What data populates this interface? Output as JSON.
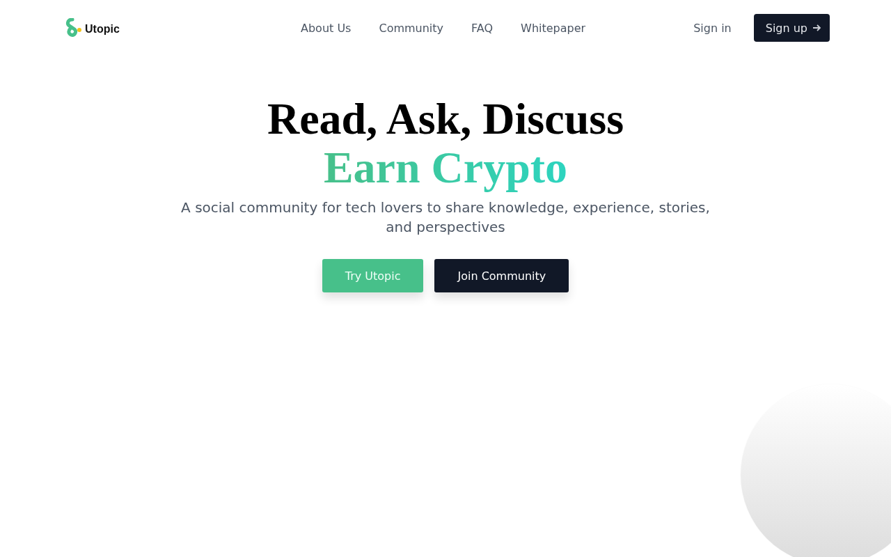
{
  "logo": {
    "text": "Utopic"
  },
  "nav": [
    "About Us",
    "Community",
    "FAQ",
    "Whitepaper"
  ],
  "auth": {
    "sign_in": "Sign in",
    "sign_up": "Sign up"
  },
  "hero": {
    "title": "Read, Ask, Discuss",
    "highlight": "Earn Crypto",
    "subtitle": "A social community for tech lovers to share knowledge, experience, stories, and perspectives",
    "buttons": [
      {
        "label": "Try Utopic",
        "kind": "primary"
      },
      {
        "label": "Join Community",
        "kind": "dark"
      }
    ]
  }
}
